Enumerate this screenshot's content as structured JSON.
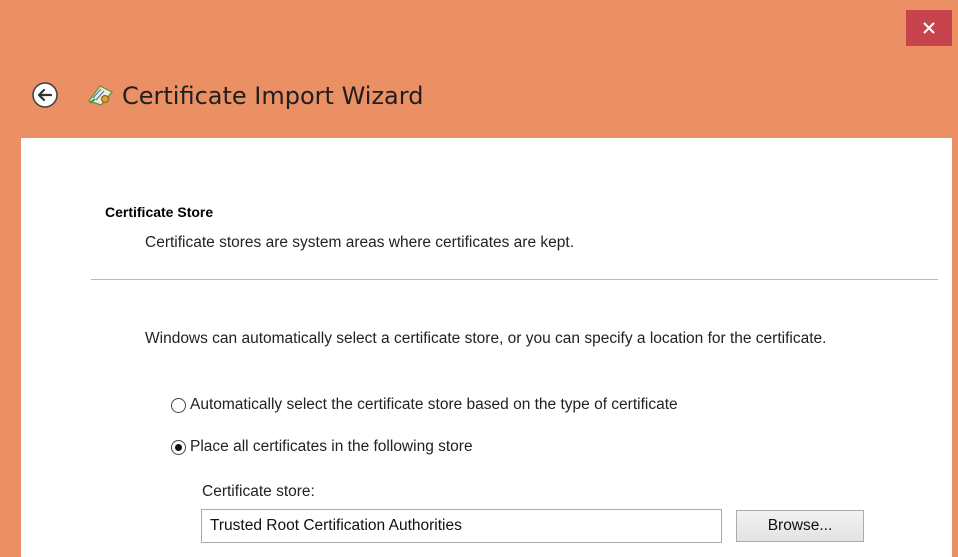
{
  "window": {
    "title": "Certificate Import Wizard",
    "close_icon": "close-icon",
    "back_icon": "back-arrow-icon",
    "app_icon": "certificate-icon",
    "colors": {
      "titlebar_bg": "#ea9064",
      "close_bg": "#c7434d",
      "content_bg": "#ffffff"
    }
  },
  "page": {
    "section_title": "Certificate Store",
    "section_desc": "Certificate stores are system areas where certificates are kept.",
    "instructions": "Windows can automatically select a certificate store, or you can specify a location for the certificate.",
    "options": [
      {
        "label": "Automatically select the certificate store based on the type of certificate",
        "selected": false
      },
      {
        "label": "Place all certificates in the following store",
        "selected": true
      }
    ],
    "store_label": "Certificate store:",
    "store_value": "Trusted Root Certification Authorities",
    "browse_label": "Browse..."
  }
}
